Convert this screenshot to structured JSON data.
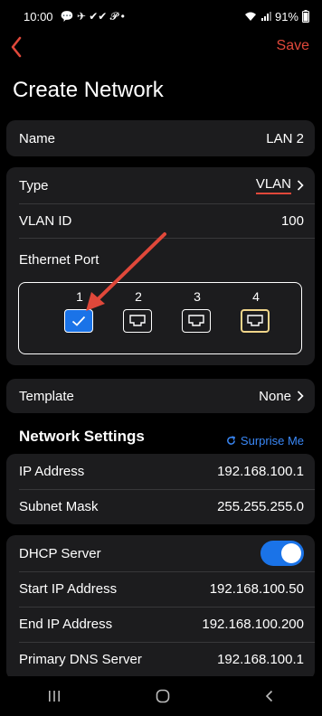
{
  "status_bar": {
    "time": "10:00",
    "notification_icons": "💬 ✈ ✔✔ 𝓟 •",
    "battery": "91%"
  },
  "nav": {
    "save_label": "Save"
  },
  "page": {
    "title": "Create Network"
  },
  "name_card": {
    "label": "Name",
    "value": "LAN 2"
  },
  "type_card": {
    "type_label": "Type",
    "type_value": "VLAN",
    "vlan_id_label": "VLAN ID",
    "vlan_id_value": "100",
    "ethernet_label": "Ethernet Port",
    "ports": [
      {
        "number": "1",
        "state": "selected"
      },
      {
        "number": "2",
        "state": "available"
      },
      {
        "number": "3",
        "state": "available"
      },
      {
        "number": "4",
        "state": "highlighted"
      }
    ]
  },
  "template_card": {
    "label": "Template",
    "value": "None"
  },
  "network_settings": {
    "heading": "Network Settings",
    "surprise_label": "Surprise Me",
    "ip_label": "IP Address",
    "ip_value": "192.168.100.1",
    "subnet_label": "Subnet Mask",
    "subnet_value": "255.255.255.0"
  },
  "dhcp": {
    "server_label": "DHCP Server",
    "server_enabled": true,
    "start_label": "Start IP Address",
    "start_value": "192.168.100.50",
    "end_label": "End IP Address",
    "end_value": "192.168.100.200",
    "dns_label": "Primary DNS Server",
    "dns_value": "192.168.100.1"
  },
  "colors": {
    "accent_red": "#e0483a",
    "accent_blue": "#1a73e8",
    "port_highlight": "#f0d58a"
  },
  "icons": {
    "back": "chevron-left-icon",
    "chevron": "chevron-right-icon",
    "port": "ethernet-port-icon",
    "check": "checkmark-icon",
    "refresh": "refresh-icon"
  }
}
